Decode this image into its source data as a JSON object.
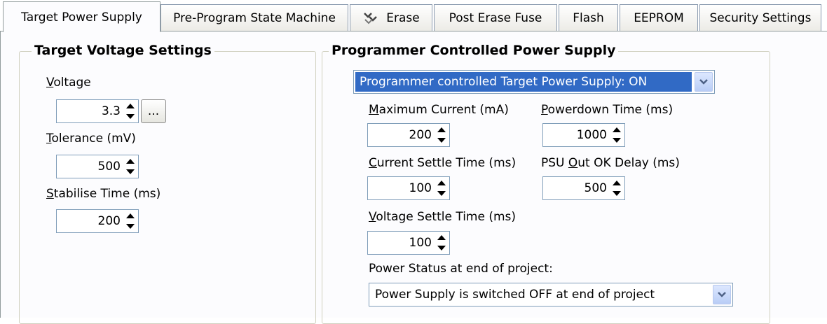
{
  "tabs": [
    {
      "label": "Target Power Supply",
      "active": true
    },
    {
      "label": "Pre-Program State Machine",
      "active": false
    },
    {
      "label": "Erase",
      "icon": "eraser-icon",
      "active": false
    },
    {
      "label": "Post Erase Fuse",
      "active": false
    },
    {
      "label": "Flash",
      "active": false
    },
    {
      "label": "EEPROM",
      "active": false
    },
    {
      "label": "Security Settings",
      "active": false
    }
  ],
  "target_voltage": {
    "title": "Target Voltage Settings",
    "voltage": {
      "label_key": "V",
      "label_rest": "oltage",
      "value": "3.3",
      "browse_label": "..."
    },
    "tolerance": {
      "label_key": "T",
      "label_rest": "olerance  (mV)",
      "value": "500"
    },
    "stabilise": {
      "label_key": "S",
      "label_rest": "tabilise Time (ms)",
      "value": "200"
    }
  },
  "programmer_power": {
    "title": "Programmer Controlled Power Supply",
    "mode_select": {
      "value": "Programmer controlled Target Power Supply: ON"
    },
    "max_current": {
      "label_key": "M",
      "label_rest": "aximum Current (mA)",
      "value": "200"
    },
    "powerdown": {
      "label_key": "P",
      "label_rest": "owerdown Time (ms)",
      "value": "1000"
    },
    "current_settle": {
      "label_key": "C",
      "label_rest": "urrent Settle Time (ms)",
      "value": "100"
    },
    "psu_ok": {
      "label_pre": "PSU ",
      "label_key": "O",
      "label_rest": "ut OK Delay (ms)",
      "value": "500"
    },
    "voltage_settle": {
      "label_key": "V",
      "label_rest": "oltage Settle Time (ms)",
      "value": "100"
    },
    "end_status_label": "Power Status at end of project:",
    "end_status_select": {
      "value": "Power Supply is switched OFF at end of project"
    }
  },
  "colors": {
    "selection": "#316ac5",
    "border": "#7f9db9",
    "group_border": "#d0d0bf"
  }
}
